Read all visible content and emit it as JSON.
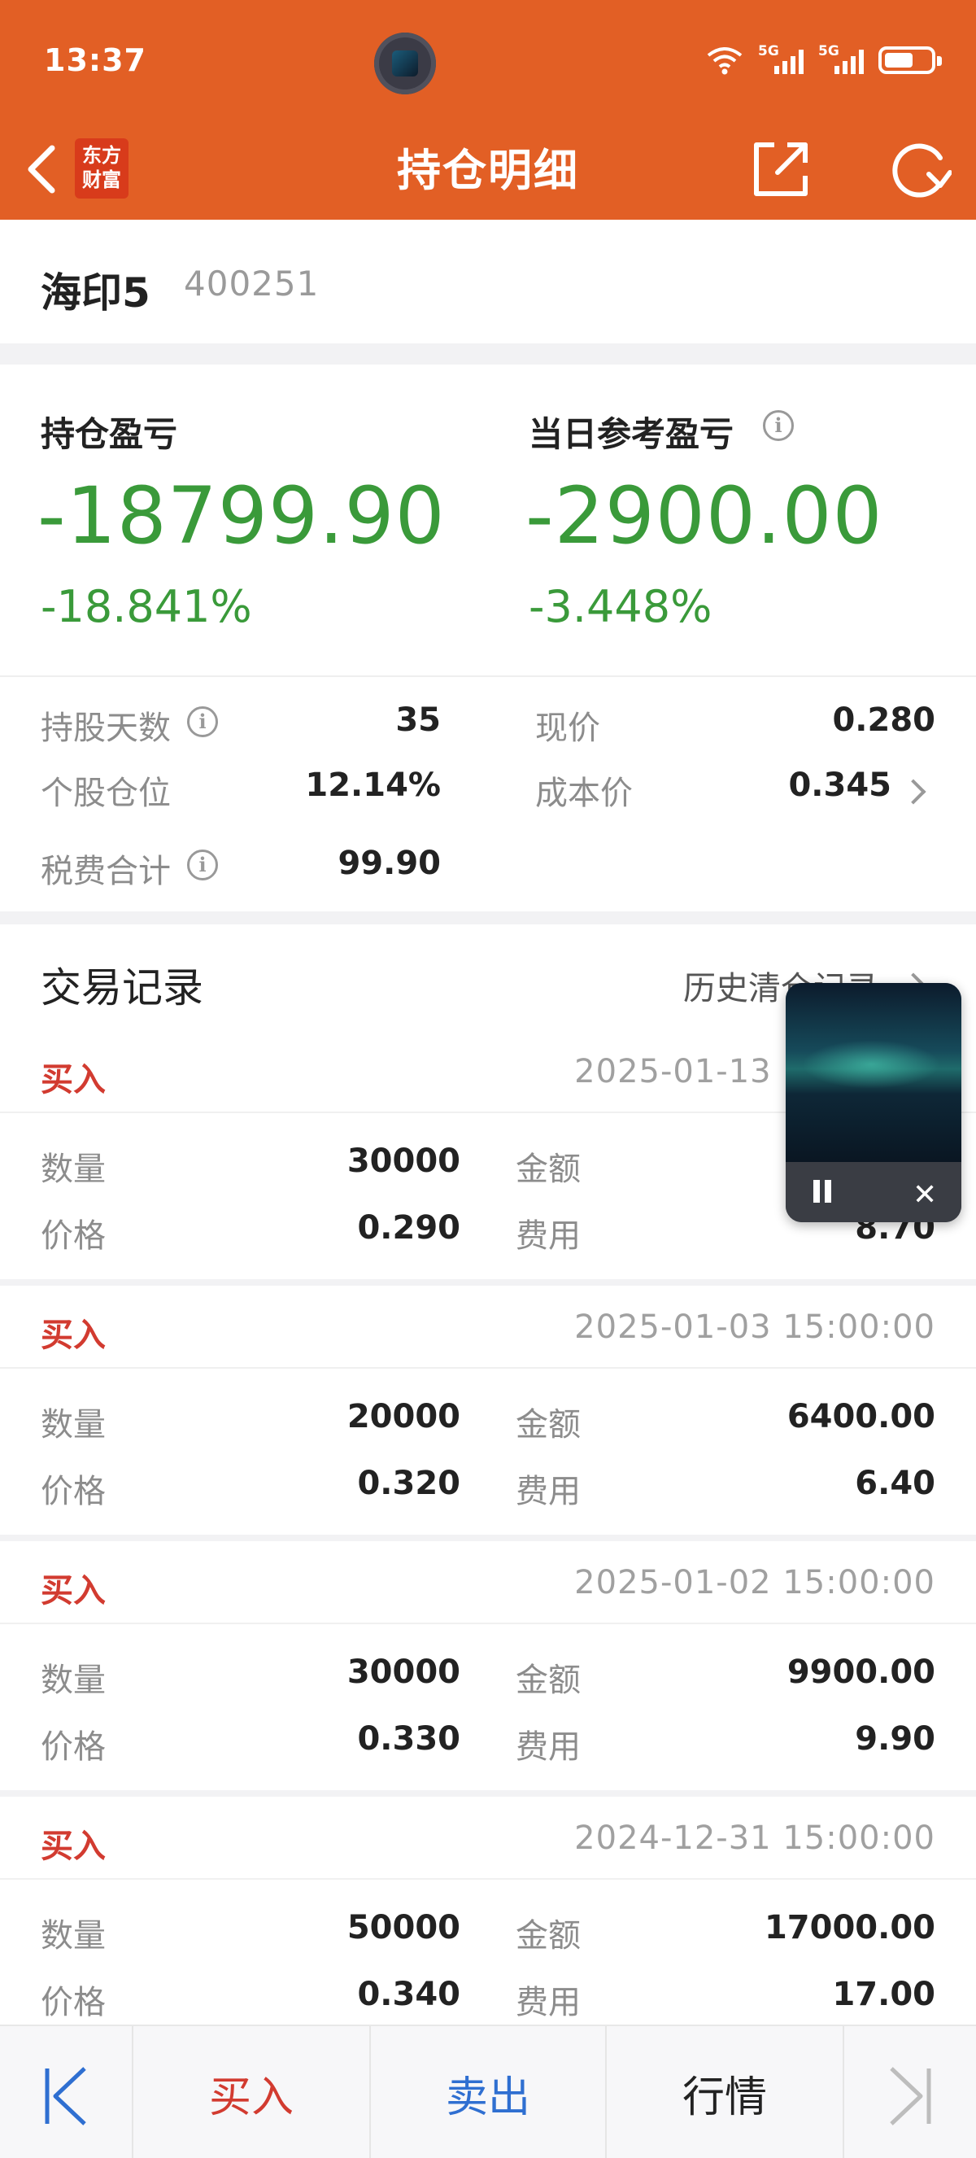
{
  "status_bar": {
    "time": "13:37",
    "network_1": "5G",
    "network_2": "5G"
  },
  "navbar": {
    "title": "持仓明细",
    "brand_line1": "东方",
    "brand_line2": "财富"
  },
  "stock": {
    "name": "海印5",
    "code": "400251"
  },
  "pnl": {
    "position_label": "持仓盈亏",
    "position_value": "-18799.90",
    "position_pct": "-18.841%",
    "daily_label": "当日参考盈亏",
    "daily_value": "-2900.00",
    "daily_pct": "-3.448%"
  },
  "stats": {
    "hold_days_label": "持股天数",
    "hold_days_value": "35",
    "position_ratio_label": "个股仓位",
    "position_ratio_value": "12.14%",
    "fees_label": "税费合计",
    "fees_value": "99.90",
    "price_label": "现价",
    "price_value": "0.280",
    "cost_label": "成本价",
    "cost_value": "0.345"
  },
  "trades_section": {
    "title": "交易记录",
    "history_link": "历史清仓记录"
  },
  "trade_labels": {
    "qty": "数量",
    "price": "价格",
    "amount": "金额",
    "fee": "费用"
  },
  "trades": [
    {
      "side": "买入",
      "time": "2025-01-13 15:00:00",
      "qty": "30000",
      "price": "0.290",
      "amount": "",
      "fee": "8.70"
    },
    {
      "side": "买入",
      "time": "2025-01-03 15:00:00",
      "qty": "20000",
      "price": "0.320",
      "amount": "6400.00",
      "fee": "6.40"
    },
    {
      "side": "买入",
      "time": "2025-01-02 15:00:00",
      "qty": "30000",
      "price": "0.330",
      "amount": "9900.00",
      "fee": "9.90"
    },
    {
      "side": "买入",
      "time": "2024-12-31 15:00:00",
      "qty": "50000",
      "price": "0.340",
      "amount": "17000.00",
      "fee": "17.00"
    }
  ],
  "bottom_bar": {
    "buy": "买入",
    "sell": "卖出",
    "quote": "行情"
  },
  "colors": {
    "header": "#e25f25",
    "loss_green": "#3a9a3a",
    "buy_red": "#d23b30",
    "sell_blue": "#2f6fd1"
  },
  "icons": [
    "back-arrow-icon",
    "share-icon",
    "refresh-icon",
    "info-icon",
    "chevron-right-icon",
    "pause-icon",
    "close-icon",
    "first-page-icon",
    "last-page-icon",
    "wifi-icon",
    "battery-icon"
  ]
}
